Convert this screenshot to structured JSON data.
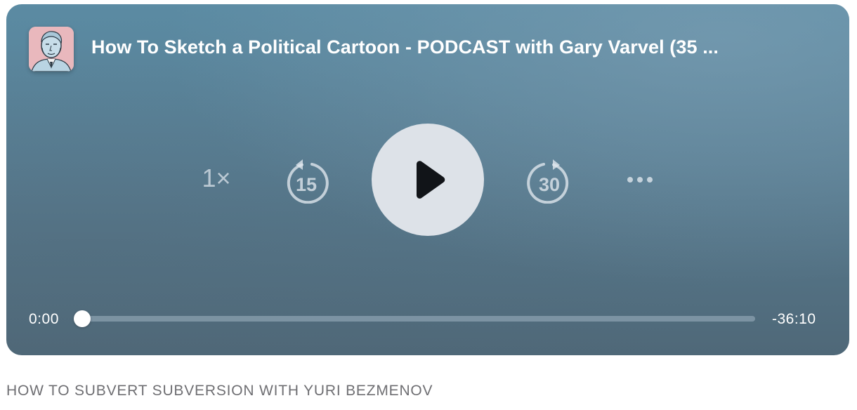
{
  "player": {
    "episode_title": "How To Sketch a Political Cartoon - PODCAST with Gary Varvel (35 ...",
    "artwork_icon": "podcast-artwork-portrait",
    "controls": {
      "speed_label": "1×",
      "skip_back_label": "15",
      "skip_back_icon": "skip-back-icon",
      "play_icon": "play-icon",
      "skip_forward_label": "30",
      "skip_forward_icon": "skip-forward-icon",
      "more_icon": "ellipsis-icon"
    },
    "progress": {
      "elapsed": "0:00",
      "remaining": "-36:10",
      "fraction": 0
    }
  },
  "show": {
    "title": "HOW TO SUBVERT SUBVERSION WITH YURI BEZMENOV"
  },
  "colors": {
    "player_top": "#5b8ba3",
    "player_bottom": "#4f6878",
    "play_button_bg": "#dde2e8",
    "control_tint": "#e1e8ee"
  }
}
